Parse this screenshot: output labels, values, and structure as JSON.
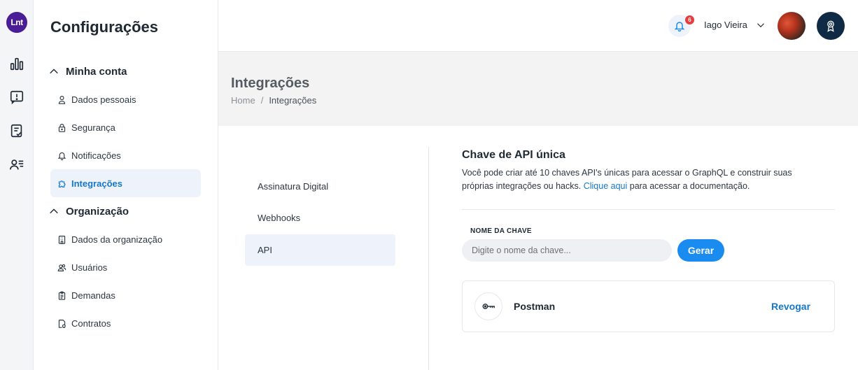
{
  "rail": {
    "logo_text": "Lnt",
    "logo_color": "#4a1d96",
    "items": [
      {
        "icon": "bar-chart-icon"
      },
      {
        "icon": "alert-message-icon"
      },
      {
        "icon": "checklist-icon"
      },
      {
        "icon": "contacts-list-icon"
      }
    ]
  },
  "settings": {
    "title": "Configurações",
    "groups": [
      {
        "label": "Minha conta",
        "items": [
          {
            "label": "Dados pessoais",
            "icon": "user-icon"
          },
          {
            "label": "Segurança",
            "icon": "lock-icon"
          },
          {
            "label": "Notificações",
            "icon": "bell-icon"
          },
          {
            "label": "Integrações",
            "icon": "puzzle-icon",
            "active": true
          }
        ]
      },
      {
        "label": "Organização",
        "items": [
          {
            "label": "Dados da organização",
            "icon": "building-icon"
          },
          {
            "label": "Usuários",
            "icon": "users-icon"
          },
          {
            "label": "Demandas",
            "icon": "clipboard-icon"
          },
          {
            "label": "Contratos",
            "icon": "contract-icon"
          }
        ]
      }
    ]
  },
  "header": {
    "notification_count": "6",
    "user_name": "Iago Vieira",
    "accent_color": "#1a8cf0"
  },
  "page": {
    "title": "Integrações",
    "breadcrumb": {
      "home": "Home",
      "separator": "/",
      "current": "Integrações"
    }
  },
  "subnav": {
    "items": [
      {
        "label": "Assinatura Digital"
      },
      {
        "label": "Webhooks"
      },
      {
        "label": "API",
        "active": true
      }
    ]
  },
  "api": {
    "title": "Chave de API única",
    "description_before": "Você pode criar até 10 chaves API's únicas para acessar o GraphQL e construir suas próprias integrações ou hacks. ",
    "link_text": "Clique aqui",
    "description_after": " para acessar a documentação.",
    "field_label": "NOME DA CHAVE",
    "input_placeholder": "Digite o nome da chave...",
    "input_value": "",
    "generate_label": "Gerar",
    "keys": [
      {
        "name": "Postman",
        "icon": "key-icon",
        "action_label": "Revogar"
      }
    ]
  }
}
